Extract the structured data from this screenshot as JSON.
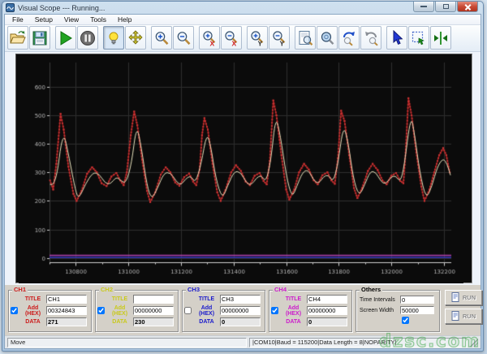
{
  "window": {
    "title": "Visual Scope  ---  Running..."
  },
  "menu": {
    "items": [
      "File",
      "Setup",
      "View",
      "Tools",
      "Help"
    ]
  },
  "toolbar": {
    "icons": [
      "folder-open",
      "save",
      "play",
      "pause",
      "light-bulb",
      "move",
      "zoom-in",
      "zoom-out",
      "zoom-x-in",
      "zoom-x-out",
      "zoom-y-in",
      "zoom-y-out",
      "zoom-page",
      "zoom-window",
      "zoom-undo",
      "zoom-redo",
      "cursor",
      "select-region",
      "markers"
    ],
    "active_icon": "light-bulb"
  },
  "chart_data": {
    "type": "line",
    "title": "",
    "xlabel": "",
    "ylabel": "",
    "xlim": [
      130700,
      132228
    ],
    "ylim": [
      -15,
      685
    ],
    "x_ticks": [
      130800,
      131000,
      131200,
      131400,
      131600,
      131800,
      132000,
      132200
    ],
    "x_minor_step": 100,
    "y_ticks": [
      0,
      100,
      200,
      300,
      400,
      500,
      600
    ],
    "grid": "on",
    "bg_color": "#0b0b0b",
    "grid_color": "#2d2d2d",
    "axis_color": "#cfcfcf",
    "label_color": "#b4b4b4",
    "series": [
      {
        "name": "CH1",
        "color": "#a81e1e",
        "marker_color": "#c83232",
        "markers": true,
        "points": [
          [
            130702,
            272
          ],
          [
            130714,
            240
          ],
          [
            130726,
            330
          ],
          [
            130742,
            505
          ],
          [
            130754,
            450
          ],
          [
            130772,
            320
          ],
          [
            130791,
            225
          ],
          [
            130803,
            200
          ],
          [
            130822,
            235
          ],
          [
            130843,
            295
          ],
          [
            130862,
            318
          ],
          [
            130880,
            300
          ],
          [
            130898,
            262
          ],
          [
            130917,
            252
          ],
          [
            130935,
            285
          ],
          [
            130954,
            298
          ],
          [
            130969,
            272
          ],
          [
            130982,
            255
          ],
          [
            130994,
            300
          ],
          [
            131009,
            430
          ],
          [
            131022,
            513
          ],
          [
            131034,
            465
          ],
          [
            131052,
            345
          ],
          [
            131071,
            235
          ],
          [
            131083,
            196
          ],
          [
            131102,
            230
          ],
          [
            131123,
            292
          ],
          [
            131142,
            318
          ],
          [
            131160,
            300
          ],
          [
            131178,
            265
          ],
          [
            131194,
            253
          ],
          [
            131212,
            283
          ],
          [
            131231,
            296
          ],
          [
            131246,
            268
          ],
          [
            131258,
            255
          ],
          [
            131271,
            310
          ],
          [
            131280,
            430
          ],
          [
            131289,
            490
          ],
          [
            131302,
            450
          ],
          [
            131320,
            330
          ],
          [
            131338,
            230
          ],
          [
            131351,
            200
          ],
          [
            131369,
            238
          ],
          [
            131391,
            300
          ],
          [
            131409,
            325
          ],
          [
            131428,
            305
          ],
          [
            131446,
            268
          ],
          [
            131462,
            255
          ],
          [
            131480,
            288
          ],
          [
            131499,
            298
          ],
          [
            131514,
            270
          ],
          [
            131526,
            258
          ],
          [
            131538,
            340
          ],
          [
            131551,
            552
          ],
          [
            131563,
            500
          ],
          [
            131582,
            360
          ],
          [
            131600,
            240
          ],
          [
            131612,
            205
          ],
          [
            131631,
            240
          ],
          [
            131649,
            300
          ],
          [
            131668,
            330
          ],
          [
            131686,
            310
          ],
          [
            131705,
            272
          ],
          [
            131720,
            258
          ],
          [
            131738,
            290
          ],
          [
            131757,
            300
          ],
          [
            131772,
            272
          ],
          [
            131785,
            260
          ],
          [
            131797,
            350
          ],
          [
            131809,
            516
          ],
          [
            131822,
            480
          ],
          [
            131840,
            360
          ],
          [
            131858,
            245
          ],
          [
            131871,
            210
          ],
          [
            131889,
            245
          ],
          [
            131911,
            305
          ],
          [
            131929,
            330
          ],
          [
            131948,
            308
          ],
          [
            131966,
            272
          ],
          [
            131982,
            258
          ],
          [
            132000,
            288
          ],
          [
            132018,
            298
          ],
          [
            132034,
            270
          ],
          [
            132046,
            262
          ],
          [
            132055,
            380
          ],
          [
            132065,
            560
          ],
          [
            132077,
            500
          ],
          [
            132095,
            370
          ],
          [
            132114,
            250
          ],
          [
            132126,
            200
          ],
          [
            132145,
            240
          ],
          [
            132163,
            300
          ],
          [
            132182,
            360
          ],
          [
            132197,
            385
          ],
          [
            132209,
            360
          ],
          [
            132222,
            300
          ]
        ]
      },
      {
        "name": "CH2",
        "color": "#e8e2bc",
        "markers": false,
        "points": [
          [
            130702,
            258
          ],
          [
            130723,
            245
          ],
          [
            130751,
            455
          ],
          [
            130775,
            350
          ],
          [
            130800,
            230
          ],
          [
            130812,
            208
          ],
          [
            130837,
            260
          ],
          [
            130865,
            300
          ],
          [
            130889,
            295
          ],
          [
            130911,
            262
          ],
          [
            130932,
            258
          ],
          [
            130954,
            285
          ],
          [
            130972,
            270
          ],
          [
            130991,
            262
          ],
          [
            131012,
            330
          ],
          [
            131031,
            468
          ],
          [
            131049,
            390
          ],
          [
            131071,
            250
          ],
          [
            131089,
            205
          ],
          [
            131111,
            245
          ],
          [
            131135,
            298
          ],
          [
            131160,
            300
          ],
          [
            131182,
            268
          ],
          [
            131200,
            255
          ],
          [
            131218,
            278
          ],
          [
            131237,
            288
          ],
          [
            131255,
            262
          ],
          [
            131277,
            330
          ],
          [
            131298,
            440
          ],
          [
            131314,
            390
          ],
          [
            131332,
            280
          ],
          [
            131357,
            205
          ],
          [
            131378,
            255
          ],
          [
            131403,
            305
          ],
          [
            131428,
            300
          ],
          [
            131449,
            262
          ],
          [
            131468,
            255
          ],
          [
            131486,
            280
          ],
          [
            131505,
            290
          ],
          [
            131523,
            265
          ],
          [
            131542,
            340
          ],
          [
            131560,
            500
          ],
          [
            131578,
            430
          ],
          [
            131600,
            290
          ],
          [
            131622,
            210
          ],
          [
            131640,
            250
          ],
          [
            131662,
            300
          ],
          [
            131683,
            310
          ],
          [
            131705,
            272
          ],
          [
            131723,
            260
          ],
          [
            131742,
            285
          ],
          [
            131760,
            292
          ],
          [
            131779,
            265
          ],
          [
            131797,
            330
          ],
          [
            131818,
            470
          ],
          [
            131837,
            400
          ],
          [
            131855,
            280
          ],
          [
            131877,
            215
          ],
          [
            131898,
            255
          ],
          [
            131920,
            305
          ],
          [
            131942,
            300
          ],
          [
            131960,
            268
          ],
          [
            131978,
            258
          ],
          [
            131997,
            282
          ],
          [
            132015,
            290
          ],
          [
            132034,
            265
          ],
          [
            132049,
            320
          ],
          [
            132074,
            505
          ],
          [
            132089,
            430
          ],
          [
            132108,
            300
          ],
          [
            132132,
            205
          ],
          [
            132154,
            250
          ],
          [
            132175,
            320
          ],
          [
            132197,
            350
          ],
          [
            132212,
            330
          ],
          [
            132225,
            290
          ]
        ]
      },
      {
        "name": "CH3",
        "color": "#3c3cc8",
        "markers": false,
        "points": [
          [
            130700,
            2
          ],
          [
            132228,
            2
          ]
        ]
      },
      {
        "name": "CH4",
        "color": "#b040b0",
        "markers": false,
        "points": [
          [
            130700,
            9
          ],
          [
            132228,
            9
          ]
        ]
      }
    ]
  },
  "channels": [
    {
      "group": "CH1",
      "color": "#cc1a1a",
      "title_label": "TITLE",
      "title_value": "CH1",
      "add_label": "Add (HEX)",
      "add_checked": true,
      "add_value": "00324843",
      "data_label": "DATA",
      "data_value": "271"
    },
    {
      "group": "CH2",
      "color": "#c9c91a",
      "title_label": "TITLE",
      "title_value": "",
      "add_label": "Add (HEX)",
      "add_checked": true,
      "add_value": "00000000",
      "data_label": "DATA",
      "data_value": "230"
    },
    {
      "group": "CH3",
      "color": "#1a1acc",
      "title_label": "TITLE",
      "title_value": "CH3",
      "add_label": "Add (HEX)",
      "add_checked": false,
      "add_value": "00000000",
      "data_label": "DATA",
      "data_value": "0"
    },
    {
      "group": "CH4",
      "color": "#cc1acc",
      "title_label": "TITLE",
      "title_value": "CH4",
      "add_label": "Add (HEX)",
      "add_checked": true,
      "add_value": "00000000",
      "data_label": "DATA",
      "data_value": "0"
    }
  ],
  "others": {
    "legend": "Others",
    "time_intervals_label": "Time Intervals",
    "time_intervals_value": "0",
    "screen_width_label": "Screen Width",
    "screen_width_value": "50000",
    "extra_checkbox_checked": true
  },
  "run_buttons": [
    {
      "label": "RUN"
    },
    {
      "label": "RUN"
    }
  ],
  "statusbar": {
    "left": "Move",
    "right": "|COM10|Baud = 115200|Data Length = 8|NOPARITY|"
  },
  "watermark": {
    "text": "dzsc.com"
  }
}
